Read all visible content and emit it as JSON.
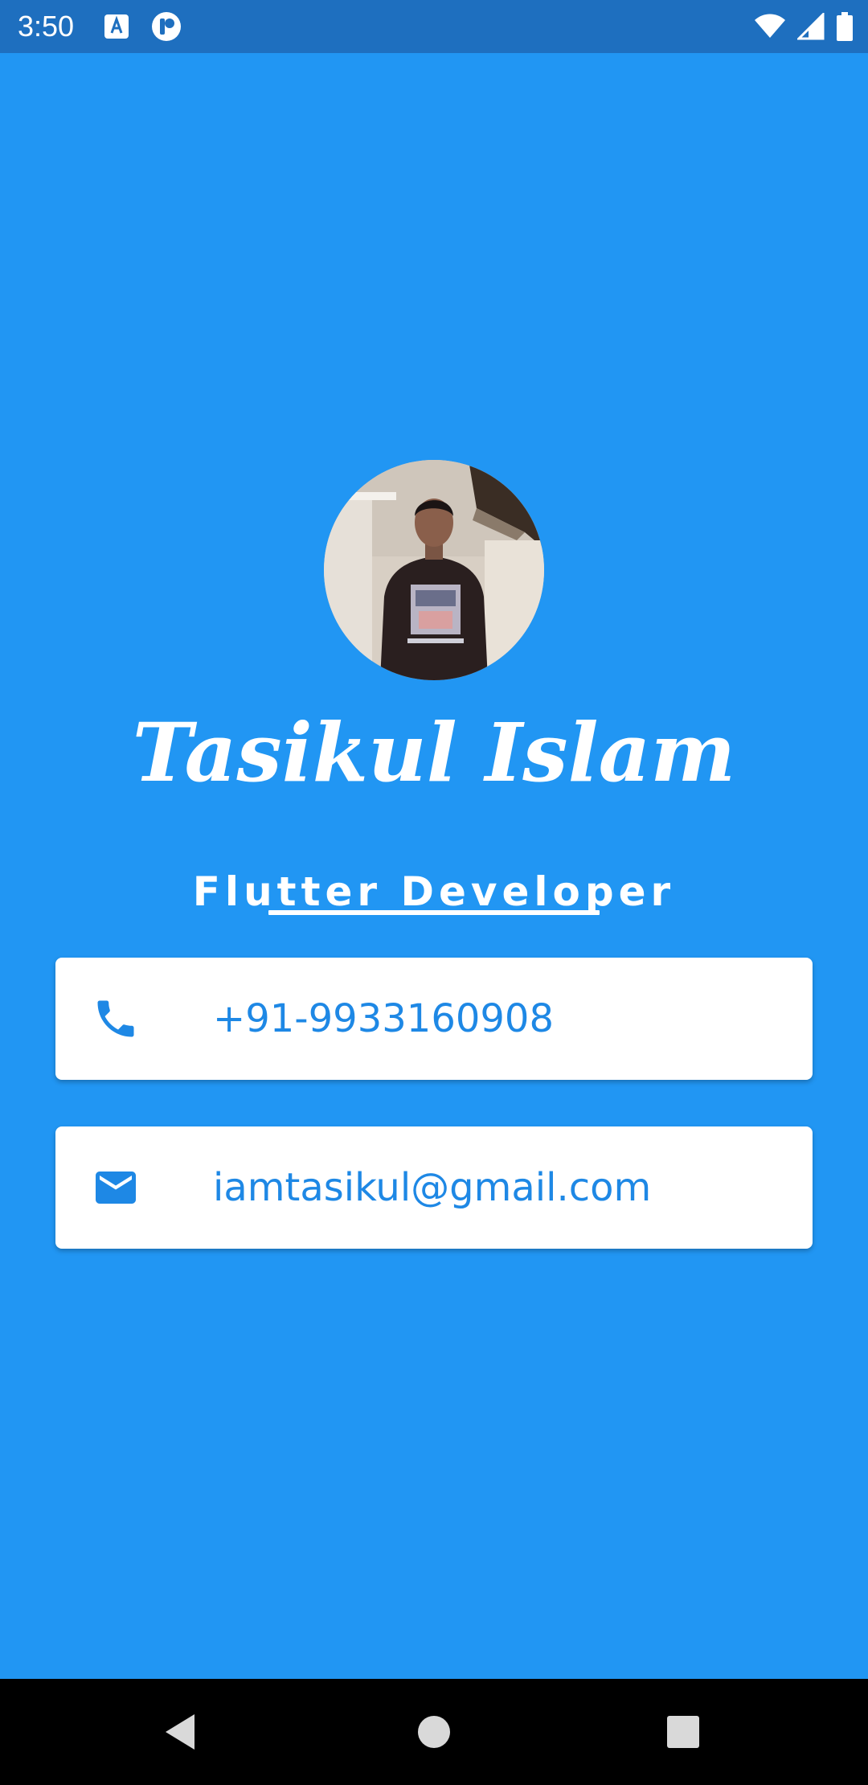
{
  "status_bar": {
    "time": "3:50",
    "left_icons": [
      "a-badge-icon",
      "p-badge-icon"
    ],
    "right_icons": [
      "wifi-icon",
      "signal-icon",
      "battery-icon"
    ]
  },
  "profile": {
    "avatar": "profile-photo",
    "name": "Tasikul Islam",
    "title": "Flutter Developer"
  },
  "contacts": {
    "phone": {
      "icon": "phone-icon",
      "value": "+91-9933160908"
    },
    "email": {
      "icon": "mail-icon",
      "value": "iamtasikul@gmail.com"
    }
  },
  "nav_bar": {
    "buttons": [
      "back-icon",
      "home-icon",
      "recents-icon"
    ]
  },
  "colors": {
    "background": "#2196F3",
    "status_bar": "#1E6FBF",
    "card": "#FFFFFF",
    "accent_text": "#1E88E5",
    "nav_bar": "#000000"
  }
}
